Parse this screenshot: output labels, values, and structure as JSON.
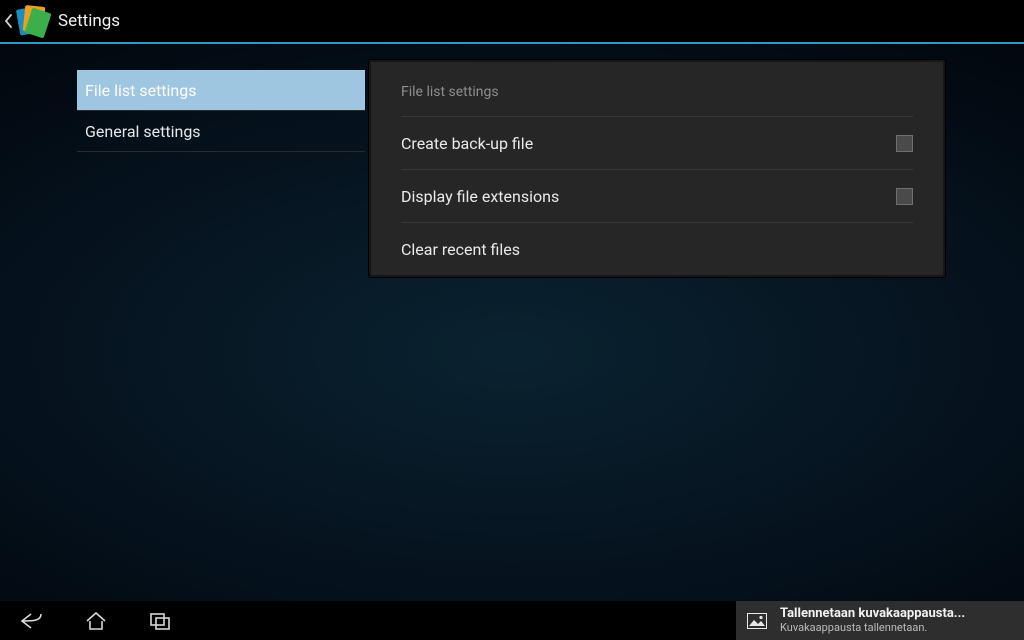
{
  "action_bar": {
    "title": "Settings"
  },
  "left_nav": {
    "items": [
      {
        "label": "File list settings",
        "selected": true
      },
      {
        "label": "General settings",
        "selected": false
      }
    ]
  },
  "panel": {
    "header": "File list settings",
    "rows": [
      {
        "label": "Create back-up file",
        "type": "checkbox",
        "checked": false
      },
      {
        "label": "Display file extensions",
        "type": "checkbox",
        "checked": false
      },
      {
        "label": "Clear recent files",
        "type": "action"
      }
    ]
  },
  "toast": {
    "title": "Tallennetaan kuvakaappausta...",
    "subtitle": "Kuvakaappausta tallennetaan."
  }
}
